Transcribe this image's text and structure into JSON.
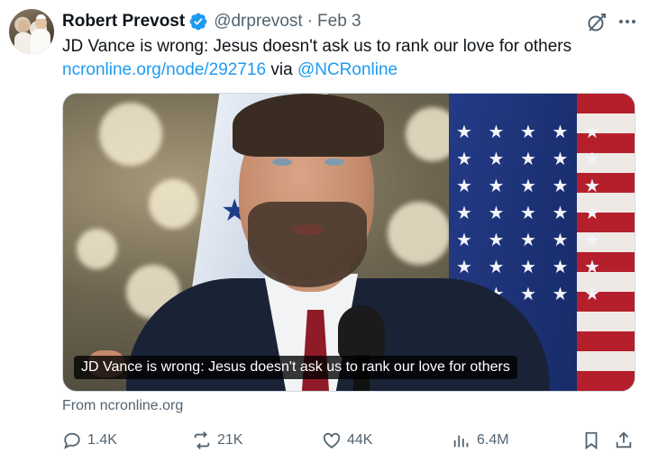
{
  "tweet": {
    "author": {
      "name": "Robert Prevost",
      "handle": "@drprevost",
      "separator": "·",
      "date": "Feb 3"
    },
    "text": {
      "main": "JD Vance is wrong: Jesus doesn't ask us to rank our love for others",
      "link": "ncronline.org/node/292716",
      "via": " via ",
      "mention": "@NCRonline"
    },
    "media": {
      "caption": "JD Vance is wrong: Jesus doesn't ask us to rank our love for others"
    },
    "source": "From ncronline.org",
    "actions": {
      "replies": "1.4K",
      "reposts": "21K",
      "likes": "44K",
      "views": "6.4M"
    }
  },
  "colors": {
    "link": "#1d9bf0",
    "secondary_text": "#536471",
    "verified": "#1d9bf0"
  },
  "icons": [
    "verified-badge-icon",
    "grok-icon",
    "more-icon",
    "reply-icon",
    "repost-icon",
    "like-icon",
    "views-icon",
    "bookmark-icon",
    "share-icon"
  ]
}
